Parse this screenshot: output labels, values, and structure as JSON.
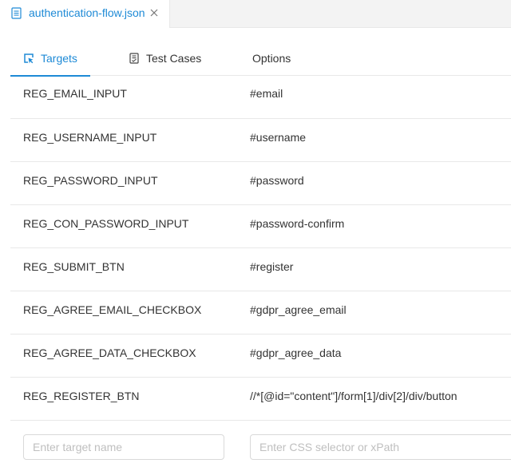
{
  "file_tab": {
    "name": "authentication-flow.json"
  },
  "tabs": [
    {
      "label": "Targets",
      "active": true,
      "icon": "target-icon"
    },
    {
      "label": "Test Cases",
      "active": false,
      "icon": "test-cases-icon"
    },
    {
      "label": "Options",
      "active": false,
      "icon": ""
    }
  ],
  "targets": [
    {
      "name": "REG_EMAIL_INPUT",
      "selector": "#email"
    },
    {
      "name": "REG_USERNAME_INPUT",
      "selector": "#username"
    },
    {
      "name": "REG_PASSWORD_INPUT",
      "selector": "#password"
    },
    {
      "name": "REG_CON_PASSWORD_INPUT",
      "selector": "#password-confirm"
    },
    {
      "name": "REG_SUBMIT_BTN",
      "selector": "#register"
    },
    {
      "name": "REG_AGREE_EMAIL_CHECKBOX",
      "selector": "#gdpr_agree_email"
    },
    {
      "name": "REG_AGREE_DATA_CHECKBOX",
      "selector": "#gdpr_agree_data"
    },
    {
      "name": "REG_REGISTER_BTN",
      "selector": "//*[@id=\"content\"]/form[1]/div[2]/div/button"
    }
  ],
  "new_target": {
    "name_placeholder": "Enter target name",
    "selector_placeholder": "Enter CSS selector or xPath"
  },
  "colors": {
    "accent": "#1e8ad6",
    "border": "#e8e8e8",
    "text": "#333333",
    "tabbar_bg": "#f3f3f3"
  }
}
